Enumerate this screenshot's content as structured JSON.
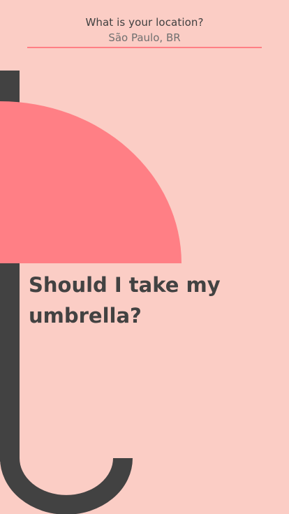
{
  "location": {
    "question": "What is your location?",
    "value": "São Paulo, BR"
  },
  "headline": "Should I take my umbrella?",
  "colors": {
    "background": "#fbcdc5",
    "canopy": "#ff7f85",
    "handle": "#424242",
    "underline": "#ff7f85",
    "text_dark": "#424242",
    "text_muted": "#707070"
  },
  "icons": [
    "umbrella-illustration"
  ]
}
